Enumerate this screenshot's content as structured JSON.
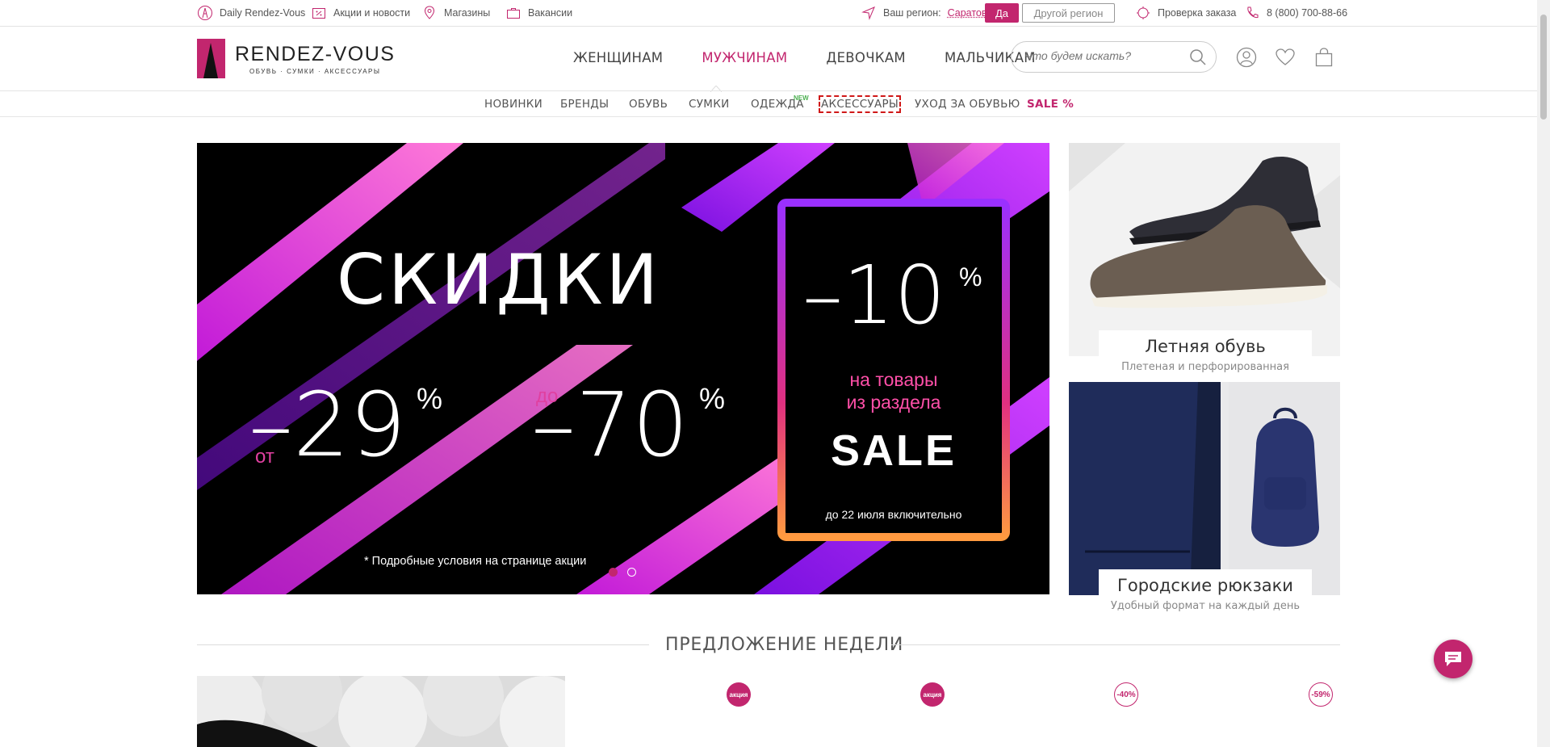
{
  "topbar": {
    "daily": "Daily Rendez-Vous",
    "promos": "Акции и новости",
    "stores": "Магазины",
    "jobs": "Вакансии",
    "region_label": "Ваш регион:",
    "region_value": "Саратов?",
    "region_yes": "Да",
    "region_other": "Другой регион",
    "order_check": "Проверка заказа",
    "phone": "8 (800) 700-88-66"
  },
  "logo": {
    "name": "RENDEZ-VOUS",
    "tagline": "ОБУВЬ · СУМКИ · АКСЕССУАРЫ"
  },
  "main_nav": {
    "items": [
      "ЖЕНЩИНАМ",
      "МУЖЧИНАМ",
      "ДЕВОЧКАМ",
      "МАЛЬЧИКАМ"
    ],
    "active": "МУЖЧИНАМ"
  },
  "search": {
    "placeholder": "Что будем искать?"
  },
  "sub_nav": {
    "items": [
      "НОВИНКИ",
      "БРЕНДЫ",
      "ОБУВЬ",
      "СУМКИ",
      "ОДЕЖДА",
      "АКСЕССУАРЫ",
      "УХОД ЗА ОБУВЬЮ",
      "SALE %"
    ],
    "new_badge": "NEW"
  },
  "hero": {
    "headline": "СКИДКИ",
    "from_prefix": "от",
    "from_value": "–29",
    "upto_prefix": "до",
    "upto_value": "–70",
    "percent": "%",
    "box_value": "–10",
    "box_line1": "на товары",
    "box_line2": "из раздела",
    "box_sale": "SALE",
    "box_until": "до 22 июля включительно",
    "footnote": "* Подробные условия на странице акции",
    "slides": 2,
    "active_slide": 1
  },
  "promos": [
    {
      "title": "Летняя обувь",
      "subtitle": "Плетеная и перфорированная"
    },
    {
      "title": "Городские рюкзаки",
      "subtitle": "Удобный формат на каждый день"
    }
  ],
  "section": {
    "title": "ПРЕДЛОЖЕНИЕ НЕДЕЛИ"
  },
  "badges": [
    "акция",
    "акция",
    "-40%",
    "-59%"
  ],
  "colors": {
    "accent": "#c2266e",
    "hero_bg": "#000000",
    "neon_pink": "#e040c8",
    "neon_violet": "#9b30ff"
  }
}
